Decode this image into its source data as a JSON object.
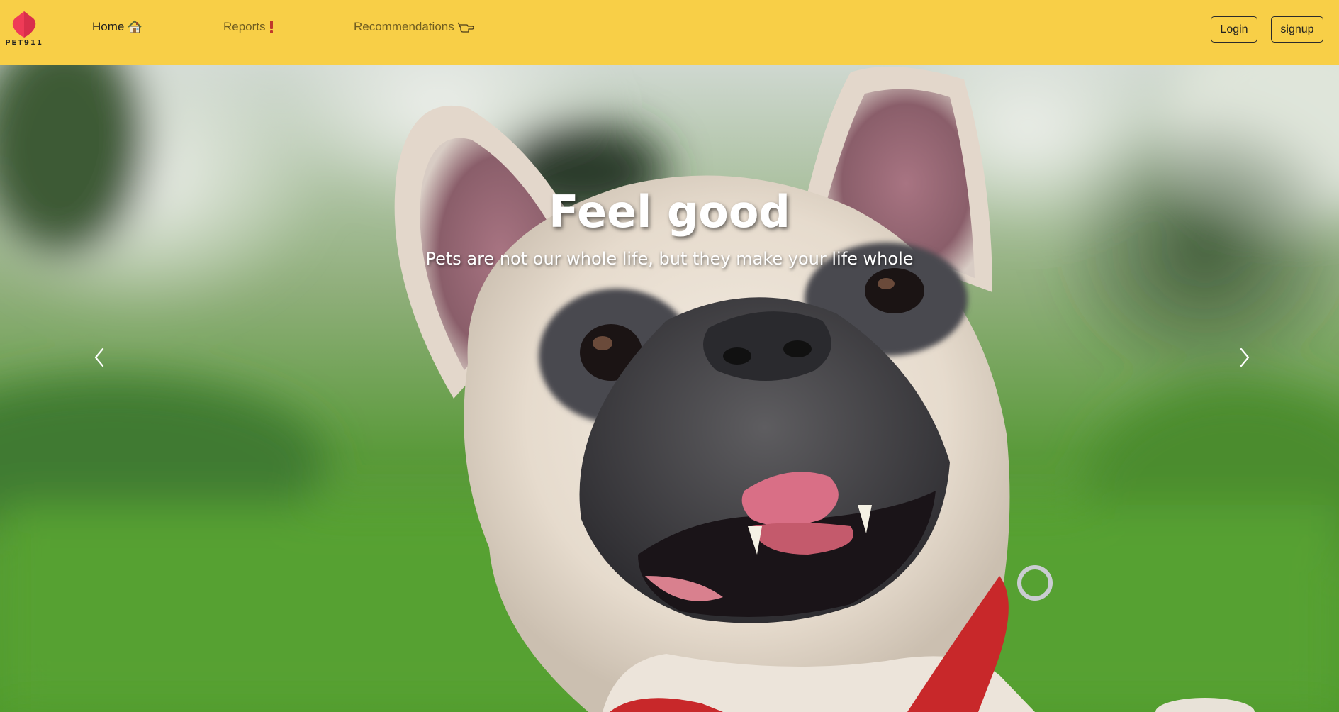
{
  "colors": {
    "navbar_bg": "#f8cf47",
    "brand_red": "#ef3b57",
    "hero_text": "#ffffff"
  },
  "brand": {
    "name": "PET911",
    "logo_icon": "shield-heart-logo"
  },
  "nav": {
    "links": [
      {
        "label": "Home",
        "icon": "house-icon",
        "active": true
      },
      {
        "label": "Reports",
        "icon": "exclamation-icon",
        "active": false
      },
      {
        "label": "Recommendations",
        "icon": "pointing-hand-icon",
        "active": false
      }
    ]
  },
  "auth": {
    "login_label": "Login",
    "signup_label": "signup"
  },
  "hero": {
    "title": "Feel good",
    "subtitle": "Pets are not our whole life, but they make your life whole",
    "image_description": "smiling french bulldog on green lawn",
    "prev_icon": "chevron-left-icon",
    "next_icon": "chevron-right-icon"
  }
}
